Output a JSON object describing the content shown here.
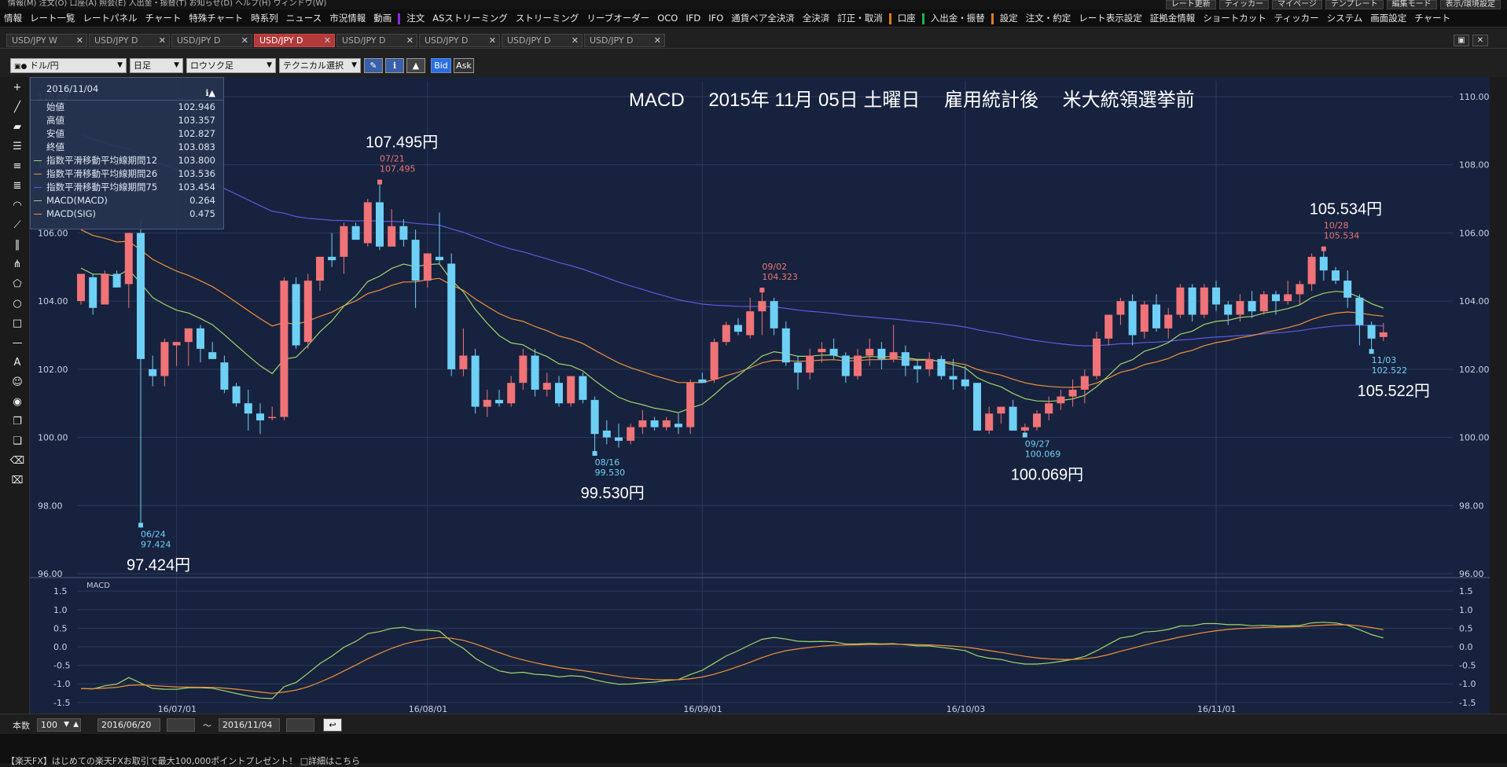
{
  "topbar": {
    "left_text": "情報(M)  注文(O)  口座(A)  照会(E)  入出金・振替(T)  お知らせ(D)  ヘルプ(H)  ウィンドウ(W)",
    "right_items": [
      "レート更新",
      "ティッカー",
      "マイページ",
      "テンプレート",
      "編集モード",
      "表示/環境設定"
    ]
  },
  "menubar": {
    "items": [
      "情報",
      "レート一覧",
      "レートパネル",
      "チャート",
      "特殊チャート",
      "時系列",
      "ニュース",
      "市況情報",
      "動画",
      "注文",
      "ASストリーミング",
      "ストリーミング",
      "リーブオーダー",
      "OCO",
      "IFD",
      "IFO",
      "通貨ペア全決済",
      "全決済",
      "訂正・取消",
      "口座",
      "入出金・振替",
      "設定",
      "注文・約定",
      "レート表示設定",
      "証拠金情報",
      "ショートカット",
      "ティッカー",
      "システム",
      "画面設定",
      "チャート"
    ]
  },
  "tabs": [
    {
      "label": "USD/JPY W",
      "active": false
    },
    {
      "label": "USD/JPY D",
      "active": false
    },
    {
      "label": "USD/JPY D",
      "active": false
    },
    {
      "label": "USD/JPY D",
      "active": true
    },
    {
      "label": "USD/JPY D",
      "active": false
    },
    {
      "label": "USD/JPY D",
      "active": false
    },
    {
      "label": "USD/JPY D",
      "active": false
    },
    {
      "label": "USD/JPY D",
      "active": false
    }
  ],
  "toolbar2": {
    "pair": "ドル/円",
    "period": "日足",
    "chart_type": "ロウソク足",
    "technical": "テクニカル選択",
    "bid": "Bid",
    "ask": "Ask"
  },
  "ohlc_box": {
    "date": "2016/11/04",
    "rows": [
      {
        "label": "始値",
        "value": "102.946",
        "color": ""
      },
      {
        "label": "高値",
        "value": "103.357",
        "color": ""
      },
      {
        "label": "安値",
        "value": "102.827",
        "color": ""
      },
      {
        "label": "終値",
        "value": "103.083",
        "color": ""
      },
      {
        "label": "指数平滑移動平均線期間12",
        "value": "103.800",
        "color": "#9fd66b"
      },
      {
        "label": "指数平滑移動平均線期間26",
        "value": "103.536",
        "color": "#f0913a"
      },
      {
        "label": "指数平滑移動平均線期間75",
        "value": "103.454",
        "color": "#5a5adf"
      },
      {
        "label": "MACD(MACD)",
        "value": "0.264",
        "color": "#9fd66b"
      },
      {
        "label": "MACD(SIG)",
        "value": "0.475",
        "color": "#f0913a"
      }
    ]
  },
  "bottombar": {
    "count_label": "本数",
    "count": "100",
    "from": "2016/06/20",
    "tilde": "〜",
    "to": "2016/11/04"
  },
  "status_text": "【楽天FX】はじめての楽天FXお取引で最大100,000ポイントプレゼント！ □詳細はこちら",
  "chart_data": {
    "type": "candlestick",
    "title": "MACD　 2015年 11月 05日 土曜日　 雇用統計後　 米大統領選挙前",
    "price_axis": {
      "ylim": [
        96,
        110
      ],
      "ticks": [
        "110.00",
        "108.00",
        "106.00",
        "104.00",
        "102.00",
        "100.00",
        "98.00",
        "96.00"
      ]
    },
    "macd_axis": {
      "ylim": [
        -1.8,
        1.8
      ],
      "ticks": [
        "1.5",
        "1.0",
        "0.5",
        "0.0",
        "-0.5",
        "-1.0",
        "-1.5"
      ],
      "label": "MACD"
    },
    "x_ticks": [
      {
        "label": "16/07/01",
        "index": 8
      },
      {
        "label": "16/08/01",
        "index": 29
      },
      {
        "label": "16/09/01",
        "index": 52
      },
      {
        "label": "16/10/03",
        "index": 74
      },
      {
        "label": "16/11/01",
        "index": 95
      }
    ],
    "candles": [
      [
        104.0,
        104.8,
        103.9,
        104.8
      ],
      [
        104.7,
        104.8,
        103.6,
        103.8
      ],
      [
        103.9,
        104.9,
        103.9,
        104.8
      ],
      [
        104.8,
        104.9,
        104.4,
        104.4
      ],
      [
        104.5,
        106.0,
        103.8,
        106.0
      ],
      [
        106.0,
        106.4,
        97.424,
        102.3
      ],
      [
        102.0,
        102.4,
        101.5,
        101.8
      ],
      [
        101.8,
        102.9,
        101.5,
        102.8
      ],
      [
        102.7,
        102.8,
        102.1,
        102.8
      ],
      [
        102.8,
        103.2,
        102.1,
        103.2
      ],
      [
        103.2,
        103.3,
        102.2,
        102.6
      ],
      [
        102.5,
        102.8,
        102.3,
        102.3
      ],
      [
        102.2,
        102.4,
        101.3,
        101.4
      ],
      [
        101.5,
        101.6,
        100.9,
        101.0
      ],
      [
        101.0,
        101.4,
        100.2,
        100.7
      ],
      [
        100.7,
        101.0,
        100.1,
        100.5
      ],
      [
        100.6,
        100.9,
        100.5,
        100.6
      ],
      [
        100.6,
        104.7,
        100.5,
        104.6
      ],
      [
        104.5,
        104.7,
        102.6,
        102.7
      ],
      [
        102.8,
        104.8,
        102.6,
        104.6
      ],
      [
        104.6,
        105.3,
        104.3,
        105.3
      ],
      [
        105.3,
        106.0,
        105.0,
        105.2
      ],
      [
        105.3,
        106.3,
        104.8,
        106.2
      ],
      [
        106.2,
        106.3,
        105.8,
        105.8
      ],
      [
        105.7,
        107.0,
        105.6,
        106.9
      ],
      [
        106.9,
        107.495,
        105.5,
        105.6
      ],
      [
        105.6,
        106.7,
        105.6,
        106.2
      ],
      [
        106.2,
        106.4,
        105.6,
        105.8
      ],
      [
        105.8,
        106.1,
        103.8,
        104.6
      ],
      [
        104.6,
        105.4,
        104.4,
        105.4
      ],
      [
        105.3,
        106.6,
        105.1,
        105.2
      ],
      [
        105.1,
        105.4,
        101.8,
        102.0
      ],
      [
        102.0,
        103.2,
        101.8,
        102.4
      ],
      [
        102.4,
        102.6,
        100.7,
        100.9
      ],
      [
        100.9,
        101.4,
        100.6,
        101.1
      ],
      [
        101.1,
        101.4,
        100.9,
        101.0
      ],
      [
        101.0,
        101.8,
        100.9,
        101.6
      ],
      [
        101.6,
        102.6,
        101.4,
        102.4
      ],
      [
        102.4,
        102.6,
        101.2,
        101.4
      ],
      [
        101.4,
        101.9,
        101.2,
        101.6
      ],
      [
        101.6,
        101.8,
        100.9,
        101.0
      ],
      [
        101.0,
        101.8,
        100.9,
        101.8
      ],
      [
        101.8,
        101.9,
        101.0,
        101.1
      ],
      [
        101.1,
        101.2,
        99.53,
        100.1
      ],
      [
        100.2,
        100.5,
        99.8,
        100.0
      ],
      [
        100.0,
        100.4,
        99.7,
        99.9
      ],
      [
        99.9,
        100.4,
        99.8,
        100.3
      ],
      [
        100.3,
        100.8,
        100.1,
        100.5
      ],
      [
        100.5,
        100.6,
        100.2,
        100.3
      ],
      [
        100.3,
        100.6,
        100.2,
        100.5
      ],
      [
        100.4,
        100.7,
        100.1,
        100.3
      ],
      [
        100.3,
        101.7,
        100.1,
        101.6
      ],
      [
        101.7,
        101.9,
        101.6,
        101.6
      ],
      [
        101.7,
        102.9,
        101.6,
        102.8
      ],
      [
        102.8,
        103.4,
        102.7,
        103.3
      ],
      [
        103.3,
        103.5,
        103.0,
        103.1
      ],
      [
        103.0,
        104.1,
        102.9,
        103.7
      ],
      [
        103.7,
        104.323,
        103.0,
        104.0
      ],
      [
        104.0,
        104.1,
        103.0,
        103.2
      ],
      [
        103.2,
        103.4,
        102.1,
        102.2
      ],
      [
        102.2,
        102.4,
        101.4,
        101.9
      ],
      [
        101.9,
        102.6,
        101.7,
        102.4
      ],
      [
        102.5,
        102.8,
        102.2,
        102.6
      ],
      [
        102.6,
        102.9,
        102.3,
        102.4
      ],
      [
        102.4,
        102.5,
        101.6,
        101.8
      ],
      [
        101.8,
        102.6,
        101.7,
        102.4
      ],
      [
        102.4,
        102.9,
        102.1,
        102.6
      ],
      [
        102.6,
        102.8,
        102.0,
        102.3
      ],
      [
        102.3,
        103.3,
        102.2,
        102.5
      ],
      [
        102.5,
        102.7,
        101.8,
        102.1
      ],
      [
        102.1,
        102.3,
        101.6,
        102.0
      ],
      [
        102.0,
        102.5,
        101.8,
        102.3
      ],
      [
        102.3,
        102.4,
        101.7,
        101.8
      ],
      [
        101.8,
        102.3,
        101.4,
        101.7
      ],
      [
        101.7,
        102.1,
        101.4,
        101.5
      ],
      [
        101.6,
        101.6,
        100.2,
        100.2
      ],
      [
        100.2,
        100.9,
        100.1,
        100.7
      ],
      [
        100.7,
        100.9,
        100.4,
        100.9
      ],
      [
        100.9,
        101.1,
        100.2,
        100.2
      ],
      [
        100.2,
        100.4,
        100.069,
        100.3
      ],
      [
        100.3,
        100.8,
        100.2,
        100.7
      ],
      [
        100.7,
        101.2,
        100.5,
        101.0
      ],
      [
        101.0,
        101.4,
        100.8,
        101.2
      ],
      [
        101.2,
        101.7,
        100.9,
        101.4
      ],
      [
        101.4,
        102.0,
        101.0,
        101.8
      ],
      [
        101.8,
        103.1,
        101.7,
        102.9
      ],
      [
        102.9,
        103.6,
        102.7,
        103.6
      ],
      [
        103.6,
        104.1,
        103.3,
        104.0
      ],
      [
        104.0,
        104.2,
        102.7,
        103.0
      ],
      [
        103.1,
        104.0,
        102.9,
        103.9
      ],
      [
        103.9,
        104.2,
        103.1,
        103.2
      ],
      [
        103.2,
        103.8,
        102.9,
        103.6
      ],
      [
        103.6,
        104.5,
        103.5,
        104.4
      ],
      [
        104.4,
        104.5,
        103.4,
        103.6
      ],
      [
        103.6,
        104.5,
        103.5,
        104.4
      ],
      [
        104.4,
        104.6,
        103.7,
        103.9
      ],
      [
        103.9,
        104.0,
        103.3,
        103.6
      ],
      [
        103.6,
        104.2,
        103.4,
        104.0
      ],
      [
        104.0,
        104.3,
        103.5,
        103.7
      ],
      [
        103.7,
        104.3,
        103.6,
        104.2
      ],
      [
        104.2,
        104.3,
        103.6,
        104.0
      ],
      [
        104.0,
        104.6,
        103.9,
        104.2
      ],
      [
        104.2,
        104.6,
        103.9,
        104.5
      ],
      [
        104.5,
        105.4,
        104.3,
        105.3
      ],
      [
        105.3,
        105.534,
        104.6,
        104.9
      ],
      [
        104.9,
        105.0,
        104.5,
        104.6
      ],
      [
        104.6,
        104.9,
        103.8,
        104.1
      ],
      [
        104.1,
        104.2,
        102.7,
        103.3
      ],
      [
        103.3,
        103.4,
        102.522,
        102.9
      ],
      [
        102.946,
        103.357,
        102.827,
        103.083
      ]
    ],
    "annotations": [
      {
        "index": 5,
        "date": "06/24",
        "price": "97.424",
        "big": "97.424円",
        "kind": "low"
      },
      {
        "index": 25,
        "date": "07/21",
        "price": "107.495",
        "big": "107.495円",
        "kind": "high"
      },
      {
        "index": 43,
        "date": "08/16",
        "price": "99.530",
        "big": "99.530円",
        "kind": "low"
      },
      {
        "index": 57,
        "date": "09/02",
        "price": "104.323",
        "big": "",
        "kind": "high"
      },
      {
        "index": 79,
        "date": "09/27",
        "price": "100.069",
        "big": "100.069円",
        "kind": "low"
      },
      {
        "index": 104,
        "date": "10/28",
        "price": "105.534",
        "big": "105.534円",
        "kind": "high"
      },
      {
        "index": 108,
        "date": "11/03",
        "price": "102.522",
        "big": "105.522円",
        "kind": "low"
      }
    ],
    "colors": {
      "up": "#ef7377",
      "down": "#6fd0f5",
      "ema12": "#9fd66b",
      "ema26": "#f0913a",
      "ema75": "#5a5adf",
      "macd": "#9fd66b",
      "sig": "#f0913a"
    }
  }
}
